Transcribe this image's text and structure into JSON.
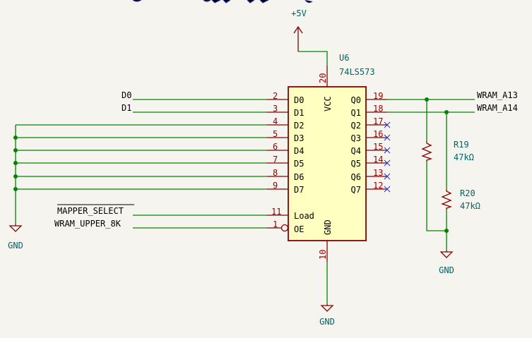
{
  "u6": {
    "ref": "U6",
    "value": "74LS573",
    "inputs": [
      {
        "name": "D0",
        "pin": "2"
      },
      {
        "name": "D1",
        "pin": "3"
      },
      {
        "name": "D2",
        "pin": "4"
      },
      {
        "name": "D3",
        "pin": "5"
      },
      {
        "name": "D4",
        "pin": "6"
      },
      {
        "name": "D5",
        "pin": "7"
      },
      {
        "name": "D6",
        "pin": "8"
      },
      {
        "name": "D7",
        "pin": "9"
      }
    ],
    "outputs": [
      {
        "name": "Q0",
        "pin": "19"
      },
      {
        "name": "Q1",
        "pin": "18"
      },
      {
        "name": "Q2",
        "pin": "17"
      },
      {
        "name": "Q3",
        "pin": "16"
      },
      {
        "name": "Q4",
        "pin": "15"
      },
      {
        "name": "Q5",
        "pin": "14"
      },
      {
        "name": "Q6",
        "pin": "13"
      },
      {
        "name": "Q7",
        "pin": "12"
      }
    ],
    "load": {
      "name": "Load",
      "pin": "11"
    },
    "oe": {
      "name": "OE",
      "pin": "1"
    },
    "vcc": {
      "name": "VCC",
      "pin": "20"
    },
    "gnd": {
      "name": "GND",
      "pin": "10"
    }
  },
  "nets": {
    "d0": "D0",
    "d1": "D1",
    "mapper_select": "MAPPER_SELECT",
    "wram_upper": "WRAM_UPPER_8K",
    "wram_a13": "WRAM_A13",
    "wram_a14": "WRAM_A14"
  },
  "power": {
    "vcc": "+5V",
    "gnd_left": "GND",
    "gnd_bottom": "GND",
    "gnd_right": "GND"
  },
  "r19": {
    "ref": "R19",
    "value": "47kΩ"
  },
  "r20": {
    "ref": "R20",
    "value": "47kΩ"
  },
  "colors": {
    "background": "#f5f4ef",
    "wire": "#008400",
    "component": "#840000",
    "body_fill": "#ffffc2",
    "reference": "#006464",
    "no_connect": "#2a34c8"
  }
}
